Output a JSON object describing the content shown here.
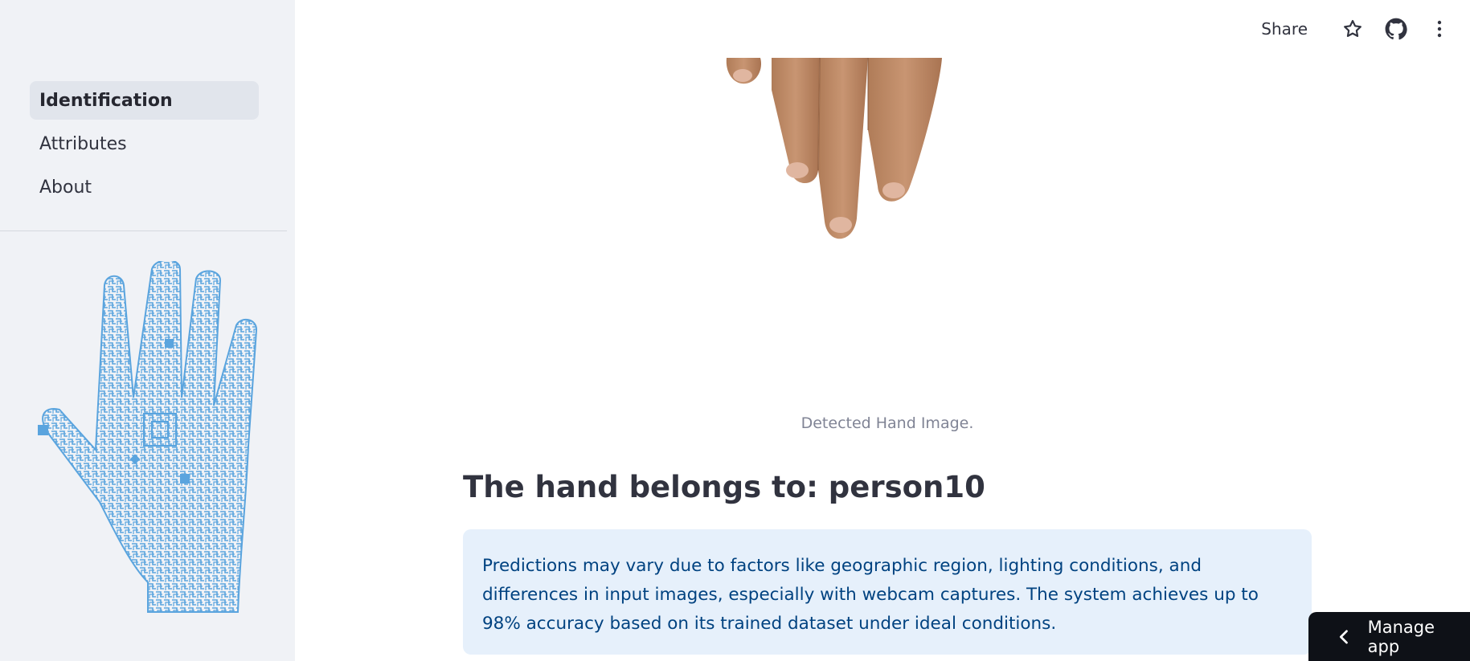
{
  "sidebar": {
    "nav_items": [
      {
        "label": "Identification",
        "active": true
      },
      {
        "label": "Attributes",
        "active": false
      },
      {
        "label": "About",
        "active": false
      }
    ],
    "logo_icon": "circuit-hand-icon",
    "logo_color": "#5aa4de"
  },
  "header": {
    "share_label": "Share",
    "icons": [
      "star-icon",
      "github-icon",
      "more-vert-icon"
    ]
  },
  "main": {
    "caption": "Detected Hand Image.",
    "result_title": "The hand belongs to: person10",
    "info_text": "Predictions may vary due to factors like geographic region, lighting conditions, and differences in input images, especially with webcam captures. The system achieves up to 98% accuracy based on its trained dataset under ideal conditions.",
    "info_color": "#004280",
    "info_bg": "#e6f0fb"
  },
  "manage_app": {
    "label": "Manage app"
  }
}
